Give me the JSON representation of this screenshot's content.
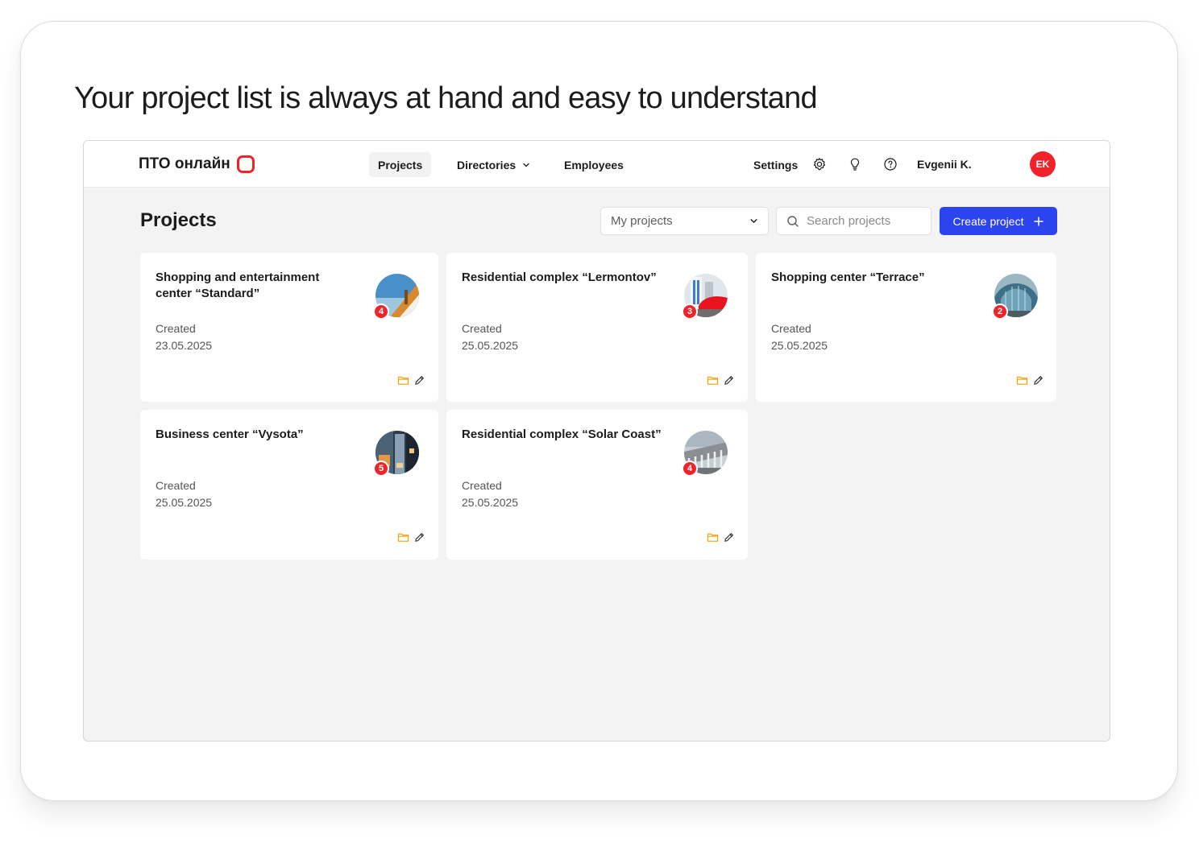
{
  "headline": "Your project list is always at hand and easy to understand",
  "brand": {
    "name": "ПТО онлайн",
    "accent": "#f0232b"
  },
  "nav": {
    "items": [
      {
        "label": "Projects",
        "active": true
      },
      {
        "label": "Directories",
        "has_dropdown": true
      },
      {
        "label": "Employees"
      }
    ],
    "settings_label": "Settings",
    "icons": [
      "gear-icon",
      "lightbulb-icon",
      "help-icon"
    ],
    "user_name": "Evgenii K.",
    "user_initials": "EK"
  },
  "page": {
    "title": "Projects",
    "filter_value": "My projects",
    "search_placeholder": "Search projects",
    "create_label": "Create project",
    "primary_color": "#2b44f0"
  },
  "projects": [
    {
      "title": "Shopping and entertainment center “Standard”",
      "created_label": "Created",
      "created_date": "23.05.2025",
      "badge": "4"
    },
    {
      "title": "Residential complex “Lermontov”",
      "created_label": "Created",
      "created_date": "25.05.2025",
      "badge": "3"
    },
    {
      "title": "Shopping center “Terrace”",
      "created_label": "Created",
      "created_date": "25.05.2025",
      "badge": "2"
    },
    {
      "title": "Business center “Vysota”",
      "created_label": "Created",
      "created_date": "25.05.2025",
      "badge": "5"
    },
    {
      "title": "Residential complex “Solar Coast”",
      "created_label": "Created",
      "created_date": "25.05.2025",
      "badge": "4"
    }
  ]
}
